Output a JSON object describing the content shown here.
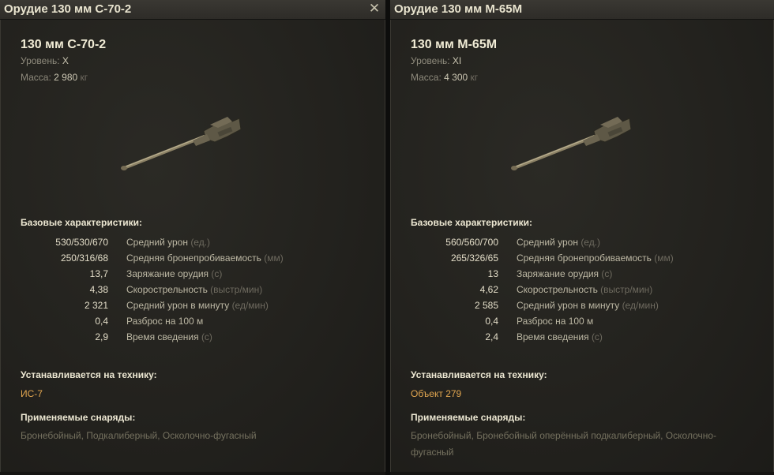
{
  "left": {
    "title": "Орудие 130 мм С-70-2",
    "name": "130 мм С-70-2",
    "level_label": "Уровень:",
    "level_value": "X",
    "mass_label": "Масса:",
    "mass_value": "2 980",
    "mass_unit": "кг",
    "base_header": "Базовые характеристики:",
    "stats": [
      {
        "value": "530/530/670",
        "label": "Средний урон",
        "unit": "(ед.)"
      },
      {
        "value": "250/316/68",
        "label": "Средняя бронепробиваемость",
        "unit": "(мм)"
      },
      {
        "value": "13,7",
        "label": "Заряжание орудия",
        "unit": "(с)"
      },
      {
        "value": "4,38",
        "label": "Скорострельность",
        "unit": "(выстр/мин)"
      },
      {
        "value": "2 321",
        "label": "Средний урон в минуту",
        "unit": "(ед/мин)"
      },
      {
        "value": "0,4",
        "label": "Разброс на 100 м",
        "unit": ""
      },
      {
        "value": "2,9",
        "label": "Время сведения",
        "unit": "(с)"
      }
    ],
    "installed_header": "Устанавливается на технику:",
    "installed_vehicle": "ИС-7",
    "shells_header": "Применяемые снаряды:",
    "shells_text": "Бронебойный, Подкалиберный, Осколочно-фугасный"
  },
  "right": {
    "title": "Орудие 130 мм М-65М",
    "name": "130 мм М-65М",
    "level_label": "Уровень:",
    "level_value": "XI",
    "mass_label": "Масса:",
    "mass_value": "4 300",
    "mass_unit": "кг",
    "base_header": "Базовые характеристики:",
    "stats": [
      {
        "value": "560/560/700",
        "label": "Средний урон",
        "unit": "(ед.)"
      },
      {
        "value": "265/326/65",
        "label": "Средняя бронепробиваемость",
        "unit": "(мм)"
      },
      {
        "value": "13",
        "label": "Заряжание орудия",
        "unit": "(с)"
      },
      {
        "value": "4,62",
        "label": "Скорострельность",
        "unit": "(выстр/мин)"
      },
      {
        "value": "2 585",
        "label": "Средний урон в минуту",
        "unit": "(ед/мин)"
      },
      {
        "value": "0,4",
        "label": "Разброс на 100 м",
        "unit": ""
      },
      {
        "value": "2,4",
        "label": "Время сведения",
        "unit": "(с)"
      }
    ],
    "installed_header": "Устанавливается на технику:",
    "installed_vehicle": "Объект 279",
    "shells_header": "Применяемые снаряды:",
    "shells_line1": "Бронебойный, Бронебойный оперённый подкалиберный, Осколочно-",
    "shells_line2": "фугасный"
  },
  "icons": {
    "close": "close-icon",
    "gun": "gun-image"
  },
  "colors": {
    "vehicle": "#e2a650",
    "title": "#e9e4cf",
    "panel_bg": "#24231f"
  }
}
